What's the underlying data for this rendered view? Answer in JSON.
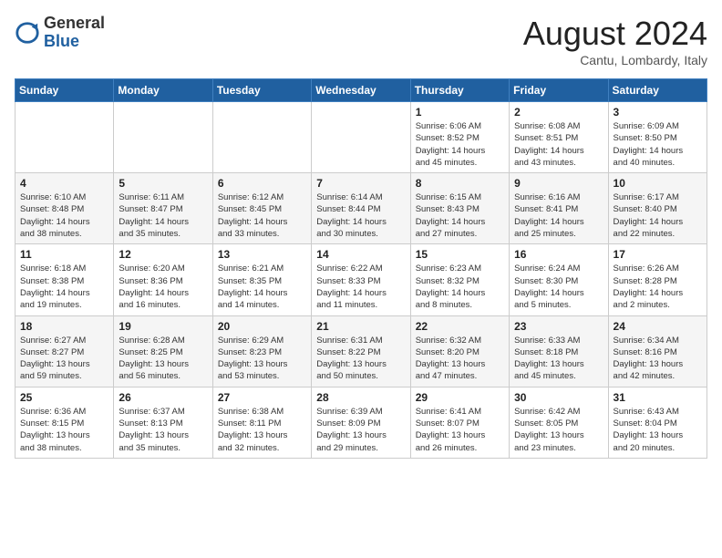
{
  "header": {
    "logo_general": "General",
    "logo_blue": "Blue",
    "month_title": "August 2024",
    "location": "Cantu, Lombardy, Italy"
  },
  "weekdays": [
    "Sunday",
    "Monday",
    "Tuesday",
    "Wednesday",
    "Thursday",
    "Friday",
    "Saturday"
  ],
  "weeks": [
    [
      {
        "day": "",
        "info": ""
      },
      {
        "day": "",
        "info": ""
      },
      {
        "day": "",
        "info": ""
      },
      {
        "day": "",
        "info": ""
      },
      {
        "day": "1",
        "info": "Sunrise: 6:06 AM\nSunset: 8:52 PM\nDaylight: 14 hours\nand 45 minutes."
      },
      {
        "day": "2",
        "info": "Sunrise: 6:08 AM\nSunset: 8:51 PM\nDaylight: 14 hours\nand 43 minutes."
      },
      {
        "day": "3",
        "info": "Sunrise: 6:09 AM\nSunset: 8:50 PM\nDaylight: 14 hours\nand 40 minutes."
      }
    ],
    [
      {
        "day": "4",
        "info": "Sunrise: 6:10 AM\nSunset: 8:48 PM\nDaylight: 14 hours\nand 38 minutes."
      },
      {
        "day": "5",
        "info": "Sunrise: 6:11 AM\nSunset: 8:47 PM\nDaylight: 14 hours\nand 35 minutes."
      },
      {
        "day": "6",
        "info": "Sunrise: 6:12 AM\nSunset: 8:45 PM\nDaylight: 14 hours\nand 33 minutes."
      },
      {
        "day": "7",
        "info": "Sunrise: 6:14 AM\nSunset: 8:44 PM\nDaylight: 14 hours\nand 30 minutes."
      },
      {
        "day": "8",
        "info": "Sunrise: 6:15 AM\nSunset: 8:43 PM\nDaylight: 14 hours\nand 27 minutes."
      },
      {
        "day": "9",
        "info": "Sunrise: 6:16 AM\nSunset: 8:41 PM\nDaylight: 14 hours\nand 25 minutes."
      },
      {
        "day": "10",
        "info": "Sunrise: 6:17 AM\nSunset: 8:40 PM\nDaylight: 14 hours\nand 22 minutes."
      }
    ],
    [
      {
        "day": "11",
        "info": "Sunrise: 6:18 AM\nSunset: 8:38 PM\nDaylight: 14 hours\nand 19 minutes."
      },
      {
        "day": "12",
        "info": "Sunrise: 6:20 AM\nSunset: 8:36 PM\nDaylight: 14 hours\nand 16 minutes."
      },
      {
        "day": "13",
        "info": "Sunrise: 6:21 AM\nSunset: 8:35 PM\nDaylight: 14 hours\nand 14 minutes."
      },
      {
        "day": "14",
        "info": "Sunrise: 6:22 AM\nSunset: 8:33 PM\nDaylight: 14 hours\nand 11 minutes."
      },
      {
        "day": "15",
        "info": "Sunrise: 6:23 AM\nSunset: 8:32 PM\nDaylight: 14 hours\nand 8 minutes."
      },
      {
        "day": "16",
        "info": "Sunrise: 6:24 AM\nSunset: 8:30 PM\nDaylight: 14 hours\nand 5 minutes."
      },
      {
        "day": "17",
        "info": "Sunrise: 6:26 AM\nSunset: 8:28 PM\nDaylight: 14 hours\nand 2 minutes."
      }
    ],
    [
      {
        "day": "18",
        "info": "Sunrise: 6:27 AM\nSunset: 8:27 PM\nDaylight: 13 hours\nand 59 minutes."
      },
      {
        "day": "19",
        "info": "Sunrise: 6:28 AM\nSunset: 8:25 PM\nDaylight: 13 hours\nand 56 minutes."
      },
      {
        "day": "20",
        "info": "Sunrise: 6:29 AM\nSunset: 8:23 PM\nDaylight: 13 hours\nand 53 minutes."
      },
      {
        "day": "21",
        "info": "Sunrise: 6:31 AM\nSunset: 8:22 PM\nDaylight: 13 hours\nand 50 minutes."
      },
      {
        "day": "22",
        "info": "Sunrise: 6:32 AM\nSunset: 8:20 PM\nDaylight: 13 hours\nand 47 minutes."
      },
      {
        "day": "23",
        "info": "Sunrise: 6:33 AM\nSunset: 8:18 PM\nDaylight: 13 hours\nand 45 minutes."
      },
      {
        "day": "24",
        "info": "Sunrise: 6:34 AM\nSunset: 8:16 PM\nDaylight: 13 hours\nand 42 minutes."
      }
    ],
    [
      {
        "day": "25",
        "info": "Sunrise: 6:36 AM\nSunset: 8:15 PM\nDaylight: 13 hours\nand 38 minutes."
      },
      {
        "day": "26",
        "info": "Sunrise: 6:37 AM\nSunset: 8:13 PM\nDaylight: 13 hours\nand 35 minutes."
      },
      {
        "day": "27",
        "info": "Sunrise: 6:38 AM\nSunset: 8:11 PM\nDaylight: 13 hours\nand 32 minutes."
      },
      {
        "day": "28",
        "info": "Sunrise: 6:39 AM\nSunset: 8:09 PM\nDaylight: 13 hours\nand 29 minutes."
      },
      {
        "day": "29",
        "info": "Sunrise: 6:41 AM\nSunset: 8:07 PM\nDaylight: 13 hours\nand 26 minutes."
      },
      {
        "day": "30",
        "info": "Sunrise: 6:42 AM\nSunset: 8:05 PM\nDaylight: 13 hours\nand 23 minutes."
      },
      {
        "day": "31",
        "info": "Sunrise: 6:43 AM\nSunset: 8:04 PM\nDaylight: 13 hours\nand 20 minutes."
      }
    ]
  ]
}
